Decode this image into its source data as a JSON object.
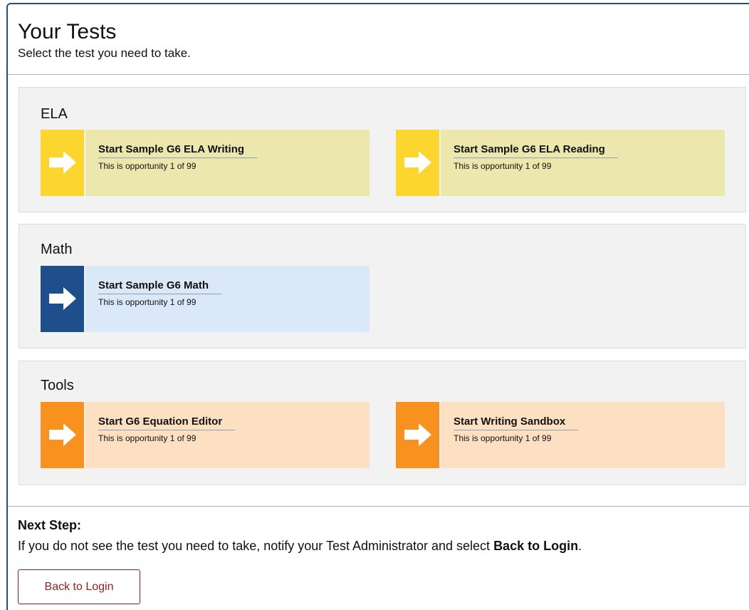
{
  "header": {
    "title": "Your Tests",
    "subtitle": "Select the test you need to take."
  },
  "groups": [
    {
      "title": "ELA",
      "color": "#fcd62f",
      "tiles": [
        {
          "title": "Start Sample G6 ELA Writing",
          "subtitle": "This is opportunity 1 of 99",
          "icon": "arrow-right-icon"
        },
        {
          "title": "Start Sample G6 ELA Reading",
          "subtitle": "This is opportunity 1 of 99",
          "icon": "arrow-right-icon"
        }
      ]
    },
    {
      "title": "Math",
      "color": "#1f4e8c",
      "tiles": [
        {
          "title": "Start Sample G6 Math",
          "subtitle": "This is opportunity 1 of 99",
          "icon": "arrow-right-icon"
        }
      ]
    },
    {
      "title": "Tools",
      "color": "#f8911e",
      "tiles": [
        {
          "title": "Start G6 Equation Editor",
          "subtitle": "This is opportunity 1 of 99",
          "icon": "arrow-right-icon"
        },
        {
          "title": "Start Writing Sandbox",
          "subtitle": "This is opportunity 1 of 99",
          "icon": "arrow-right-icon"
        }
      ]
    }
  ],
  "footer": {
    "next_step_label": "Next Step:",
    "instruction_prefix": "If you do not see the test you need to take, notify your Test Administrator and select ",
    "instruction_bold": "Back to Login",
    "instruction_suffix": ".",
    "back_button_label": "Back to Login"
  }
}
